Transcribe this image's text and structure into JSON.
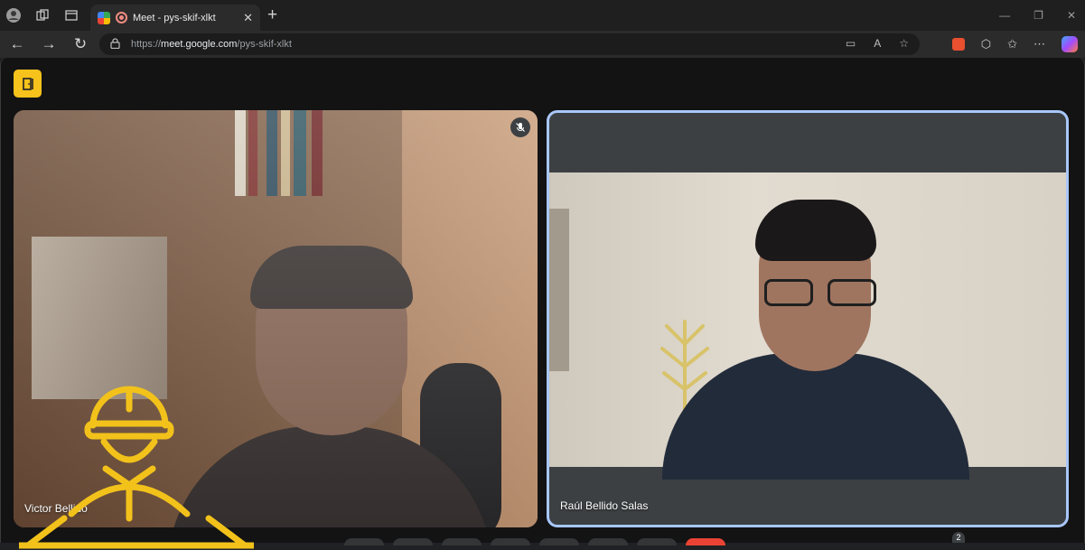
{
  "browser": {
    "tab_title": "Meet - pys-skif-xlkt",
    "url_prefix": "https://",
    "url_host": "meet.google.com",
    "url_path": "/pys-skif-xlkt"
  },
  "meet": {
    "participants": [
      {
        "name": "Victor Bellido",
        "muted": true
      },
      {
        "name": "Raúl Bellido Salas",
        "muted": false,
        "active_speaker": true
      }
    ],
    "participant_count": "2"
  },
  "colors": {
    "accent": "#f6c21b",
    "active_border": "#a8c7fa",
    "leave_red": "#ea4335"
  }
}
